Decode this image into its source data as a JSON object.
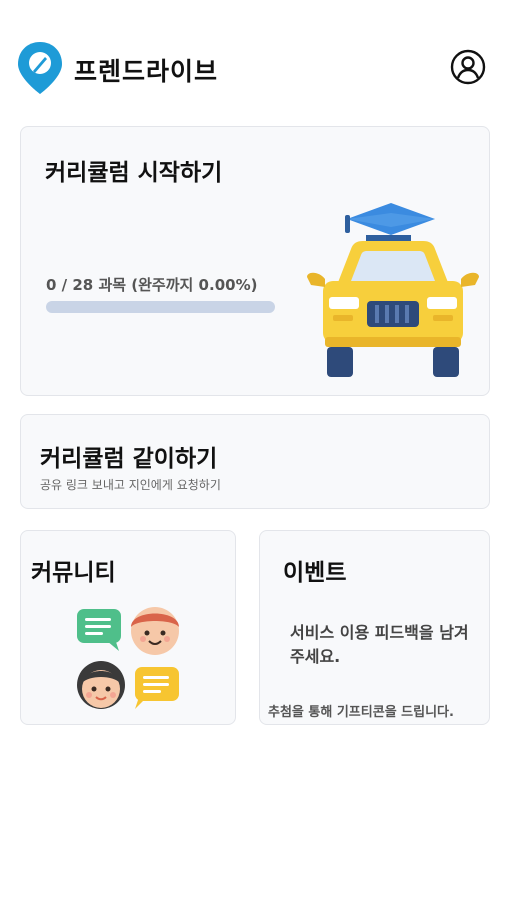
{
  "app": {
    "title": "프렌드라이브"
  },
  "curriculum_start": {
    "title": "커리큘럼 시작하기",
    "progress_text": "0 / 28 과목 (완주까지 0.00%)",
    "progress_fraction": 0.0
  },
  "curriculum_together": {
    "title": "커리큘럼 같이하기",
    "subtitle": "공유 링크 보내고 지인에게 요청하기"
  },
  "community": {
    "title": "커뮤니티"
  },
  "event": {
    "title": "이벤트",
    "description": "서비스 이용 피드백을 남겨주세요.",
    "note": "추첨을 통해 기프티콘을 드립니다."
  },
  "colors": {
    "brand": "#1e9bd7",
    "progress_track": "#c9d4e6",
    "card_bg": "#f8f9fb",
    "car_yellow": "#f7cf3c",
    "cap_blue": "#2e7ed4"
  },
  "icons": [
    "logo-pin-icon",
    "profile-icon",
    "car-icon",
    "graduation-cap-icon",
    "chat-bubble-icon",
    "face-icon"
  ]
}
